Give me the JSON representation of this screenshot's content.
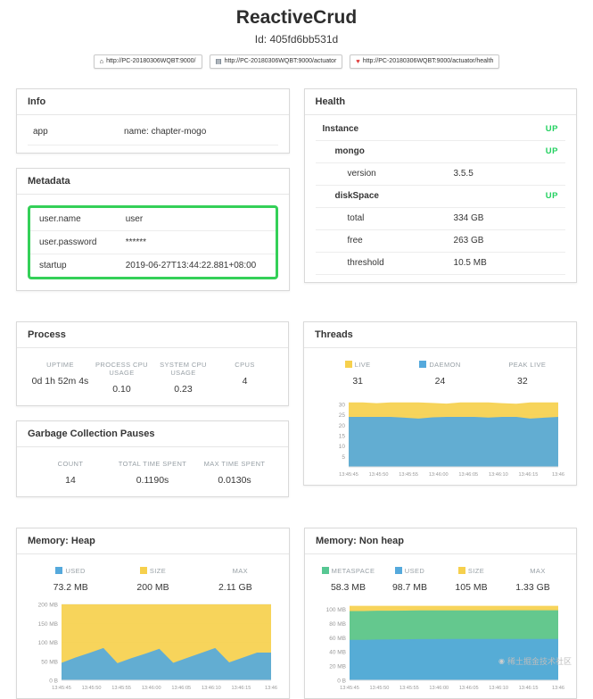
{
  "header": {
    "title": "ReactiveCrud",
    "instance_id": "Id: 405fd6bb531d",
    "links": [
      {
        "icon_name": "home-icon",
        "glyph": "⌂",
        "label": "http://PC-20180306WQBT:9000/"
      },
      {
        "icon_name": "book-icon",
        "glyph": "▤",
        "label": "http://PC-20180306WQBT:9000/actuator"
      },
      {
        "icon_name": "heart-icon",
        "glyph": "♥",
        "label": "http://PC-20180306WQBT:9000/actuator/health"
      }
    ]
  },
  "info": {
    "title": "Info",
    "rows": [
      {
        "key": "app",
        "value": "name: chapter-mogo"
      }
    ]
  },
  "metadata": {
    "title": "Metadata",
    "rows": [
      {
        "key": "user.name",
        "value": "user"
      },
      {
        "key": "user.password",
        "value": "******"
      },
      {
        "key": "startup",
        "value": "2019-06-27T13:44:22.881+08:00"
      }
    ]
  },
  "health": {
    "title": "Health",
    "rows": [
      {
        "label": "Instance",
        "value": "",
        "status": "UP"
      },
      {
        "label": "mongo",
        "value": "",
        "status": "UP"
      },
      {
        "label": "version",
        "value": "3.5.5",
        "status": ""
      },
      {
        "label": "diskSpace",
        "value": "",
        "status": "UP"
      },
      {
        "label": "total",
        "value": "334 GB",
        "status": ""
      },
      {
        "label": "free",
        "value": "263 GB",
        "status": ""
      },
      {
        "label": "threshold",
        "value": "10.5 MB",
        "status": ""
      }
    ]
  },
  "process": {
    "title": "Process",
    "stats": [
      {
        "label": "UPTIME",
        "value": "0d 1h 52m 4s"
      },
      {
        "label": "PROCESS CPU USAGE",
        "value": "0.10"
      },
      {
        "label": "SYSTEM CPU USAGE",
        "value": "0.23"
      },
      {
        "label": "CPUS",
        "value": "4"
      }
    ]
  },
  "gc": {
    "title": "Garbage Collection Pauses",
    "stats": [
      {
        "label": "COUNT",
        "value": "14"
      },
      {
        "label": "TOTAL TIME SPENT",
        "value": "0.1190s"
      },
      {
        "label": "MAX TIME SPENT",
        "value": "0.0130s"
      }
    ]
  },
  "threads": {
    "title": "Threads",
    "legend": [
      {
        "label": "LIVE",
        "value": "31",
        "color": "#f6d04d"
      },
      {
        "label": "DAEMON",
        "value": "24",
        "color": "#55a9dc"
      },
      {
        "label": "PEAK LIVE",
        "value": "32",
        "color": ""
      }
    ]
  },
  "heap": {
    "title": "Memory: Heap",
    "legend": [
      {
        "label": "USED",
        "value": "73.2 MB",
        "color": "#55a9dc"
      },
      {
        "label": "SIZE",
        "value": "200 MB",
        "color": "#f6d04d"
      },
      {
        "label": "MAX",
        "value": "2.11 GB",
        "color": ""
      }
    ]
  },
  "nonheap": {
    "title": "Memory: Non heap",
    "legend": [
      {
        "label": "METASPACE",
        "value": "58.3 MB",
        "color": "#57c793"
      },
      {
        "label": "USED",
        "value": "98.7 MB",
        "color": "#55a9dc"
      },
      {
        "label": "SIZE",
        "value": "105 MB",
        "color": "#f6d04d"
      },
      {
        "label": "MAX",
        "value": "1.33 GB",
        "color": ""
      }
    ]
  },
  "chart_data": [
    {
      "id": "threads",
      "type": "area",
      "x_labels": [
        "13:45:45",
        "13:45:50",
        "13:45:55",
        "13:46:00",
        "13:46:05",
        "13:46:10",
        "13:46:15",
        "13:46"
      ],
      "ylim": [
        0,
        33
      ],
      "yticks": [
        [
          30,
          "30"
        ],
        [
          25,
          "25"
        ],
        [
          20,
          "20"
        ],
        [
          15,
          "15"
        ],
        [
          10,
          "10"
        ],
        [
          5,
          "5"
        ]
      ],
      "areas": [
        {
          "series": "LIVE",
          "color": "#f6d04d",
          "upper": [
            31,
            31,
            30.6,
            31,
            31,
            31,
            30.7,
            30.4,
            31,
            31,
            31,
            30.6,
            30.3,
            31,
            31,
            31
          ]
        },
        {
          "series": "DAEMON",
          "color": "#55a9dc",
          "upper": [
            24,
            24,
            24,
            24,
            23.6,
            23.2,
            23.8,
            24,
            24,
            24,
            23.7,
            24,
            24,
            23.2,
            23.6,
            24
          ]
        }
      ]
    },
    {
      "id": "memory-heap",
      "type": "area",
      "x_labels": [
        "13:45:45",
        "13:45:50",
        "13:45:55",
        "13:46:00",
        "13:46:05",
        "13:46:10",
        "13:46:15",
        "13:46"
      ],
      "ylim": [
        0,
        200
      ],
      "yticks": [
        [
          200,
          "200 MB"
        ],
        [
          150,
          "150 MB"
        ],
        [
          100,
          "100 MB"
        ],
        [
          50,
          "50 MB"
        ],
        [
          0,
          "0 B"
        ]
      ],
      "areas": [
        {
          "series": "SIZE",
          "color": "#f6d04d",
          "upper": [
            200,
            200,
            200,
            200,
            200,
            200,
            200,
            200,
            200,
            200,
            200,
            200,
            200,
            200,
            200,
            200
          ]
        },
        {
          "series": "USED",
          "color": "#55a9dc",
          "upper": [
            46,
            60,
            72,
            85,
            45,
            58,
            70,
            83,
            46,
            59,
            72,
            85,
            47,
            60,
            73,
            73
          ]
        }
      ]
    },
    {
      "id": "memory-nonheap",
      "type": "area",
      "x_labels": [
        "13:45:45",
        "13:45:50",
        "13:45:55",
        "13:46:00",
        "13:46:05",
        "13:46:10",
        "13:46:15",
        "13:46"
      ],
      "ylim": [
        0,
        107
      ],
      "yticks": [
        [
          100,
          "100 MB"
        ],
        [
          80,
          "80 MB"
        ],
        [
          60,
          "60 MB"
        ],
        [
          40,
          "40 MB"
        ],
        [
          20,
          "20 MB"
        ],
        [
          0,
          "0 B"
        ]
      ],
      "areas": [
        {
          "series": "SIZE",
          "color": "#f6d04d",
          "upper": [
            105,
            105,
            105,
            105,
            105,
            105,
            105,
            105,
            105,
            105,
            105,
            105,
            105,
            105,
            105,
            105
          ]
        },
        {
          "series": "USED",
          "color": "#57c793",
          "upper": [
            97.5,
            97.5,
            98,
            98,
            98.2,
            98.4,
            98.4,
            98.5,
            98.5,
            98.6,
            98.6,
            98.7,
            98.7,
            98.7,
            98.7,
            98.7
          ]
        },
        {
          "series": "METASPACE",
          "color": "#55a9dc",
          "upper": [
            57,
            57,
            57.4,
            57.6,
            57.8,
            58,
            58,
            58.1,
            58.1,
            58.2,
            58.2,
            58.3,
            58.3,
            58.3,
            58.3,
            58.3
          ]
        }
      ]
    }
  ],
  "watermark": {
    "glyph": "◉",
    "text": "稀土掘金技术社区"
  },
  "colors": {
    "status_up": "#23d160",
    "highlight_border": "#34d058"
  }
}
